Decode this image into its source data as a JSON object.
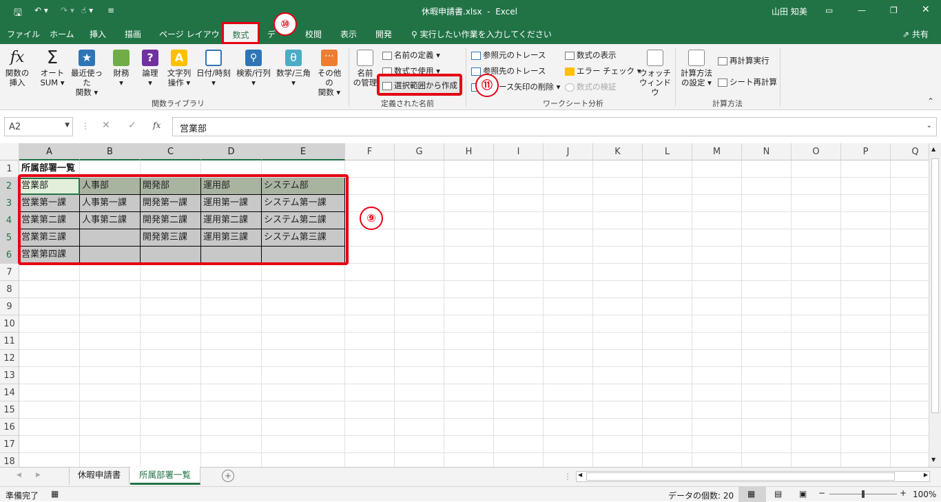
{
  "title": {
    "file": "休暇申請書.xlsx",
    "app": "Excel",
    "user": "山田 知美"
  },
  "tabs": [
    "ファイル",
    "ホーム",
    "挿入",
    "描画",
    "ページ レイアウト",
    "数式",
    "データ",
    "校閲",
    "表示",
    "開発"
  ],
  "tell_me": "実行したい作業を入力してください",
  "share": "共有",
  "badges": {
    "b10": "⑩",
    "b11": "⑪",
    "b9": "⑨"
  },
  "ribbon": {
    "insert_function": [
      "関数の",
      "挿入"
    ],
    "autosum": [
      "オート",
      "SUM ▾"
    ],
    "recent": [
      "最近使った",
      "関数 ▾"
    ],
    "financial": [
      "財務",
      "▾"
    ],
    "logical": [
      "論理",
      "▾"
    ],
    "text": [
      "文字列",
      "操作 ▾"
    ],
    "datetime": [
      "日付/時刻",
      "▾"
    ],
    "lookup": [
      "検索/行列",
      "▾"
    ],
    "math": [
      "数学/三角",
      "▾"
    ],
    "more": [
      "その他の",
      "関数 ▾"
    ],
    "name_manager": [
      "名前",
      "の管理"
    ],
    "define_name": "名前の定義 ▾",
    "use_in_formula": "数式で使用 ▾",
    "create_from_selection": "選択範囲から作成",
    "trace_precedents": "参照元のトレース",
    "trace_dependents": "参照先のトレース",
    "remove_arrows": "トレース矢印の削除 ▾",
    "show_formulas": "数式の表示",
    "error_checking": "エラー チェック ▾",
    "evaluate_formula": "数式の検証",
    "watch_window": [
      "ウォッチ",
      "ウィンドウ"
    ],
    "calc_options": [
      "計算方法",
      "の設定 ▾"
    ],
    "calc_now": "再計算実行",
    "calc_sheet": "シート再計算",
    "groups": {
      "library": "関数ライブラリ",
      "names": "定義された名前",
      "audit": "ワークシート分析",
      "calc": "計算方法"
    }
  },
  "namebox": "A2",
  "formula": "営業部",
  "columns": [
    "A",
    "B",
    "C",
    "D",
    "E",
    "F",
    "G",
    "H",
    "I",
    "J",
    "K",
    "L",
    "M",
    "N",
    "O",
    "P",
    "Q"
  ],
  "rows": [
    "1",
    "2",
    "3",
    "4",
    "5",
    "6",
    "7",
    "8",
    "9",
    "10",
    "11",
    "12",
    "13",
    "14",
    "15",
    "16",
    "17",
    "18"
  ],
  "cells": {
    "a1": "所属部署一覧",
    "r2": [
      "営業部",
      "人事部",
      "開発部",
      "運用部",
      "システム部"
    ],
    "r3": [
      "営業第一課",
      "人事第一課",
      "開発第一課",
      "運用第一課",
      "システム第一課"
    ],
    "r4": [
      "営業第二課",
      "人事第二課",
      "開発第二課",
      "運用第二課",
      "システム第二課"
    ],
    "r5": [
      "営業第三課",
      "",
      "開発第三課",
      "運用第三課",
      "システム第三課"
    ],
    "r6": [
      "営業第四課",
      "",
      "",
      "",
      ""
    ]
  },
  "sheets": [
    "休暇申請書",
    "所属部署一覧"
  ],
  "status": {
    "ready": "準備完了",
    "count": "データの個数: 20",
    "zoom": "100%"
  }
}
